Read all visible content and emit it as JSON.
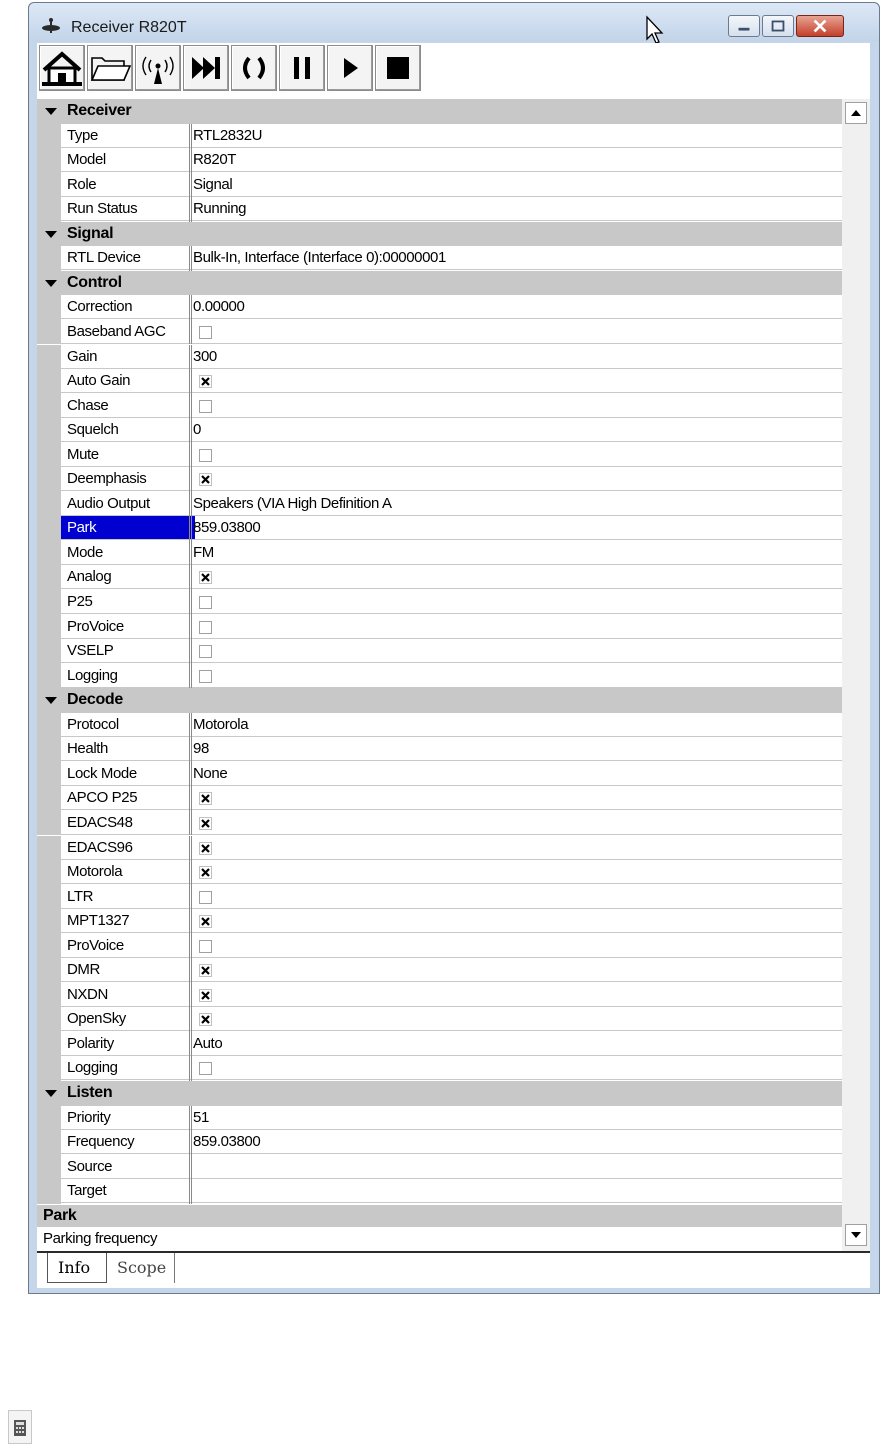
{
  "window": {
    "title": "Receiver R820T"
  },
  "toolbar": {
    "buttons": [
      {
        "name": "home-button",
        "icon": "home-icon"
      },
      {
        "name": "open-folder-button",
        "icon": "folder-icon"
      },
      {
        "name": "antenna-button",
        "icon": "antenna-icon"
      },
      {
        "name": "skip-button",
        "icon": "skip-forward-icon"
      },
      {
        "name": "cycle-button",
        "icon": "cycle-icon"
      },
      {
        "name": "pause-button",
        "icon": "pause-icon"
      },
      {
        "name": "play-button",
        "icon": "play-icon"
      },
      {
        "name": "stop-button",
        "icon": "stop-icon"
      }
    ]
  },
  "property_grid": {
    "rows": [
      {
        "type": "category",
        "label": "Receiver"
      },
      {
        "type": "text",
        "name": "Type",
        "value": "RTL2832U"
      },
      {
        "type": "text",
        "name": "Model",
        "value": "R820T"
      },
      {
        "type": "text",
        "name": "Role",
        "value": "Signal"
      },
      {
        "type": "text",
        "name": "Run Status",
        "value": "Running"
      },
      {
        "type": "category",
        "label": "Signal"
      },
      {
        "type": "text",
        "name": "RTL Device",
        "value": "Bulk-In, Interface (Interface 0):00000001"
      },
      {
        "type": "category",
        "label": "Control"
      },
      {
        "type": "text",
        "name": "Correction",
        "value": "0.00000"
      },
      {
        "type": "check",
        "name": "Baseband AGC",
        "checked": false
      },
      {
        "type": "text",
        "name": "Gain",
        "value": "300"
      },
      {
        "type": "check",
        "name": "Auto Gain",
        "checked": true
      },
      {
        "type": "check",
        "name": "Chase",
        "checked": false
      },
      {
        "type": "text",
        "name": "Squelch",
        "value": "0"
      },
      {
        "type": "check",
        "name": "Mute",
        "checked": false
      },
      {
        "type": "check",
        "name": "Deemphasis",
        "checked": true
      },
      {
        "type": "text",
        "name": "Audio Output",
        "value": "Speakers (VIA High Definition A"
      },
      {
        "type": "text",
        "name": "Park",
        "value": "859.03800",
        "selected": true
      },
      {
        "type": "text",
        "name": "Mode",
        "value": "FM"
      },
      {
        "type": "check",
        "name": "Analog",
        "checked": true
      },
      {
        "type": "check",
        "name": "P25",
        "checked": false
      },
      {
        "type": "check",
        "name": "ProVoice",
        "checked": false
      },
      {
        "type": "check",
        "name": "VSELP",
        "checked": false
      },
      {
        "type": "check",
        "name": "Logging",
        "checked": false
      },
      {
        "type": "category",
        "label": "Decode"
      },
      {
        "type": "text",
        "name": "Protocol",
        "value": "Motorola"
      },
      {
        "type": "text",
        "name": "Health",
        "value": "98"
      },
      {
        "type": "text",
        "name": "Lock Mode",
        "value": "None"
      },
      {
        "type": "check",
        "name": "APCO P25",
        "checked": true
      },
      {
        "type": "check",
        "name": "EDACS48",
        "checked": true
      },
      {
        "type": "check",
        "name": "EDACS96",
        "checked": true
      },
      {
        "type": "check",
        "name": "Motorola",
        "checked": true
      },
      {
        "type": "check",
        "name": "LTR",
        "checked": false
      },
      {
        "type": "check",
        "name": "MPT1327",
        "checked": true
      },
      {
        "type": "check",
        "name": "ProVoice",
        "checked": false
      },
      {
        "type": "check",
        "name": "DMR",
        "checked": true
      },
      {
        "type": "check",
        "name": "NXDN",
        "checked": true
      },
      {
        "type": "check",
        "name": "OpenSky",
        "checked": true
      },
      {
        "type": "text",
        "name": "Polarity",
        "value": "Auto"
      },
      {
        "type": "check",
        "name": "Logging",
        "checked": false
      },
      {
        "type": "category",
        "label": "Listen"
      },
      {
        "type": "text",
        "name": "Priority",
        "value": "51"
      },
      {
        "type": "text",
        "name": "Frequency",
        "value": "859.03800"
      },
      {
        "type": "text",
        "name": "Source",
        "value": ""
      },
      {
        "type": "text",
        "name": "Target",
        "value": ""
      }
    ]
  },
  "help": {
    "title": "Park",
    "description": "Parking frequency"
  },
  "tabs": [
    {
      "label": "Info",
      "active": true
    },
    {
      "label": "Scope",
      "active": false
    }
  ],
  "colors": {
    "selection": "#0000d0",
    "category_bg": "#c8c8c8",
    "frame": "#c5d6ea"
  }
}
